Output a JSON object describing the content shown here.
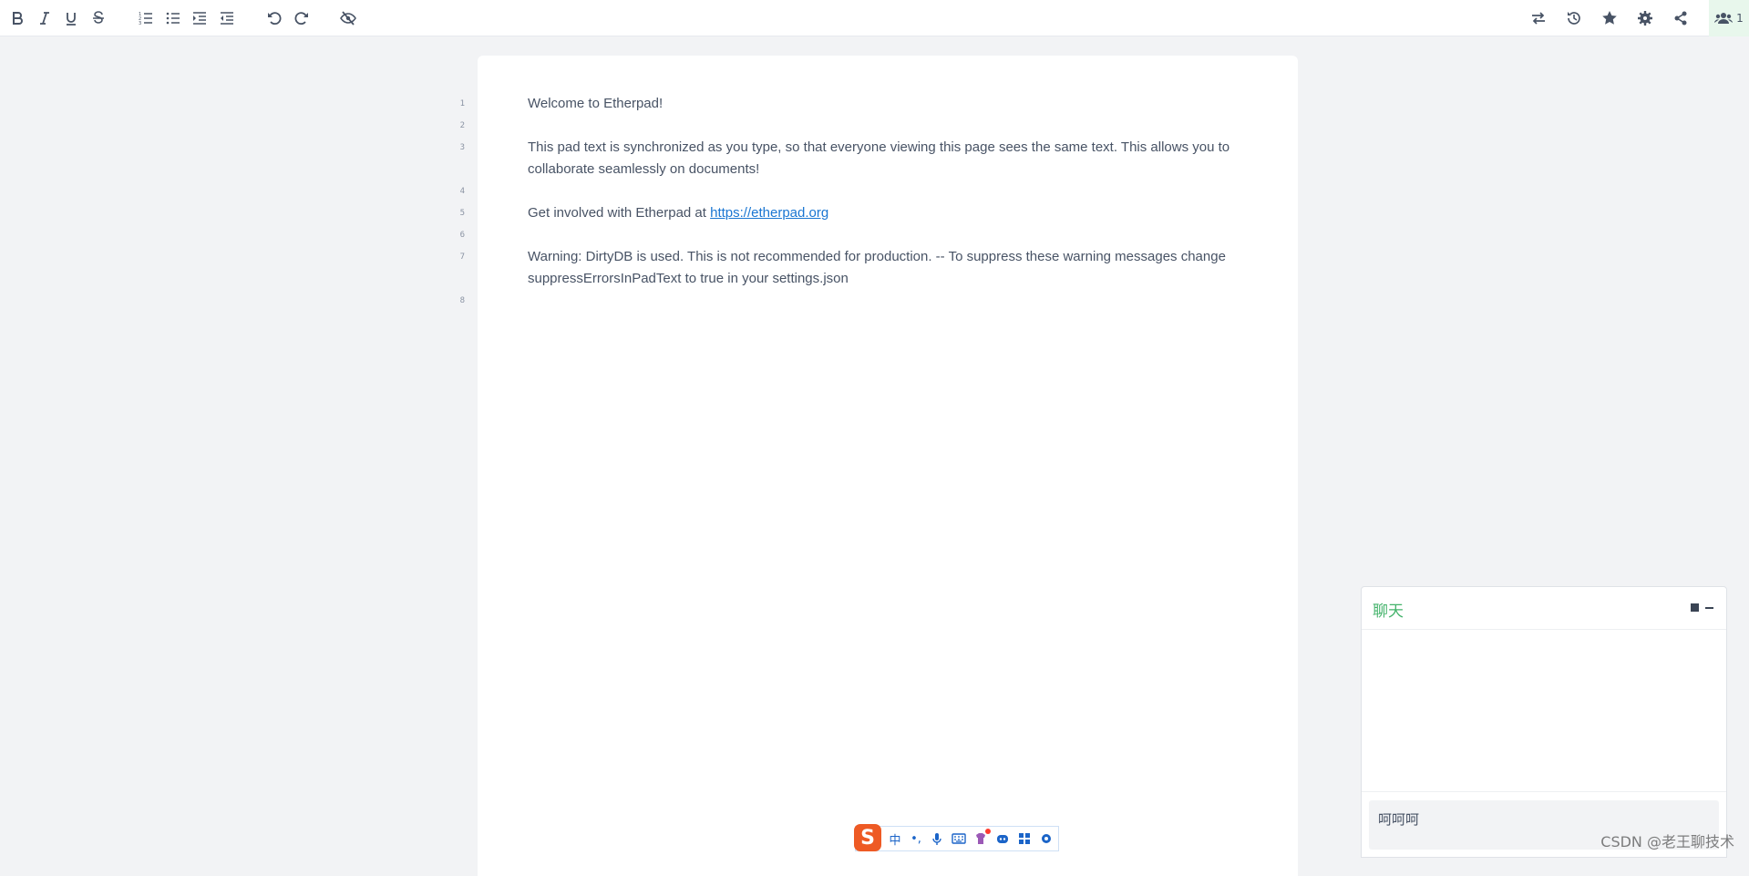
{
  "toolbar": {
    "left_buttons": [
      "bold",
      "italic",
      "underline",
      "strikethrough",
      "ordered-list",
      "unordered-list",
      "indent",
      "outdent",
      "undo",
      "redo",
      "toggle-authorship-colors"
    ],
    "right_buttons": [
      "import-export",
      "timeslider",
      "saved-revision",
      "settings",
      "share"
    ],
    "users_count": "1"
  },
  "line_numbers": [
    "1",
    "2",
    "3",
    "4",
    "5",
    "6",
    "7",
    "8"
  ],
  "pad": {
    "lines": [
      "Welcome to Etherpad!",
      "",
      "This pad text is synchronized as you type, so that everyone viewing this page sees the same text. This allows you to collaborate seamlessly on documents!",
      "",
      "Get involved with Etherpad at ",
      "",
      "Warning: DirtyDB is used. This is not recommended for production. -- To suppress these warning messages change suppressErrorsInPadText to true in your settings.json",
      ""
    ],
    "link_text": "https://etherpad.org"
  },
  "chat": {
    "title": "聊天",
    "input_value": "呵呵呵"
  },
  "ime": {
    "logo": "S",
    "lang": "中",
    "punct": "•,"
  },
  "watermark": "CSDN @老王聊技术",
  "colors": {
    "accent_green": "#44b36b",
    "link_blue": "#1a76d2",
    "background": "#f2f3f5"
  }
}
